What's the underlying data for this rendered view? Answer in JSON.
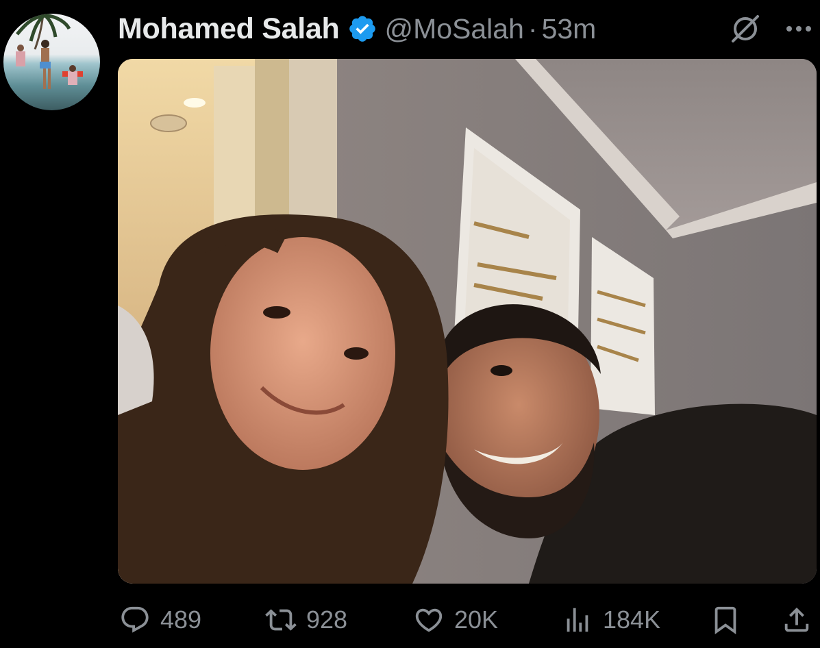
{
  "author": {
    "display_name": "Mohamed Salah",
    "handle": "@MoSalah",
    "separator": "·",
    "time": "53m",
    "verified": true
  },
  "colors": {
    "background": "#000000",
    "text_primary": "#e7e9ea",
    "text_secondary": "#8b9096",
    "verified_blue": "#1d9bf0"
  },
  "icons": {
    "verified": "verified-badge-icon",
    "grok": "grok-icon",
    "more": "more-icon",
    "reply": "reply-icon",
    "retweet": "retweet-icon",
    "like": "heart-icon",
    "views": "views-icon",
    "bookmark": "bookmark-icon",
    "share": "share-icon"
  },
  "actions": {
    "replies": "489",
    "retweets": "928",
    "likes": "20K",
    "views": "184K"
  }
}
